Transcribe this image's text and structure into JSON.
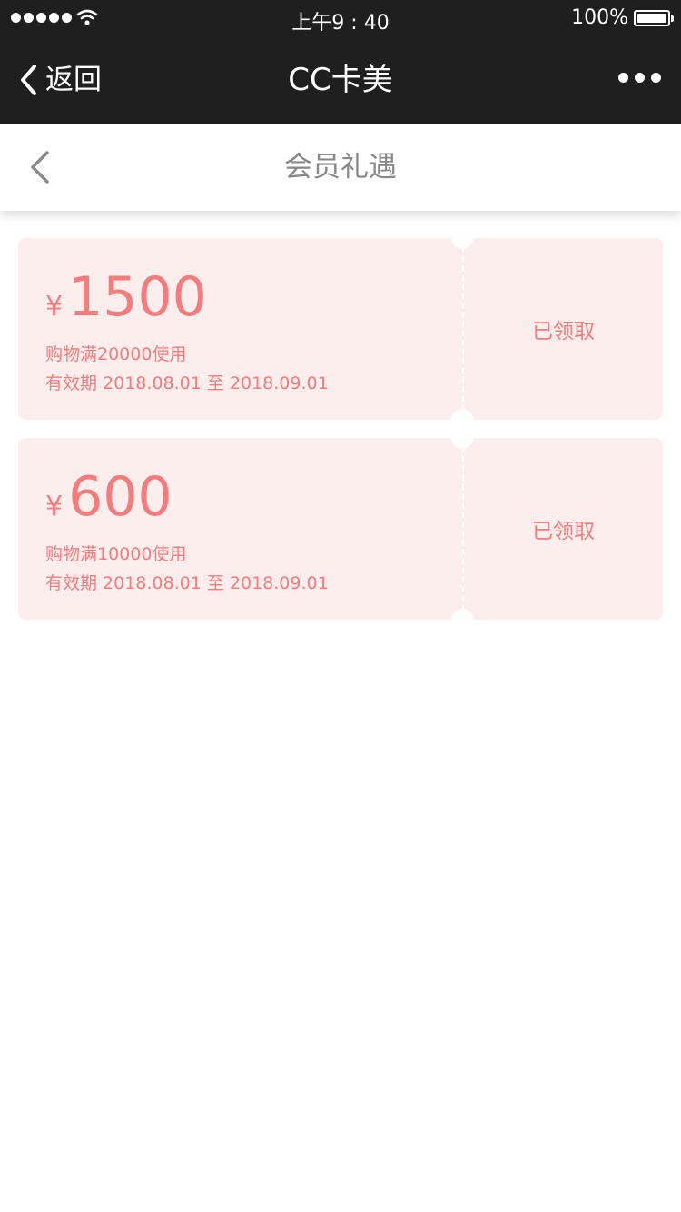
{
  "status_bar": {
    "time": "上午9 : 40",
    "battery": "100%",
    "signal_icon": "signal-dots-icon",
    "wifi_icon": "wifi-icon",
    "battery_icon": "battery-icon"
  },
  "nav": {
    "back_label": "返回",
    "title": "CC卡美",
    "more_icon": "more-dots-icon"
  },
  "page": {
    "title": "会员礼遇"
  },
  "coupons": [
    {
      "currency": "¥",
      "amount": "1500",
      "condition": "购物满20000使用",
      "validity": "有效期 2018.08.01 至 2018.09.01",
      "status": "已领取"
    },
    {
      "currency": "¥",
      "amount": "600",
      "condition": "购物满10000使用",
      "validity": "有效期 2018.08.01 至 2018.09.01",
      "status": "已领取"
    }
  ],
  "colors": {
    "bar_bg": "#1f1f1f",
    "coupon_bg": "#fdeeee",
    "accent": "#f47c7c",
    "page_title": "#888888"
  }
}
